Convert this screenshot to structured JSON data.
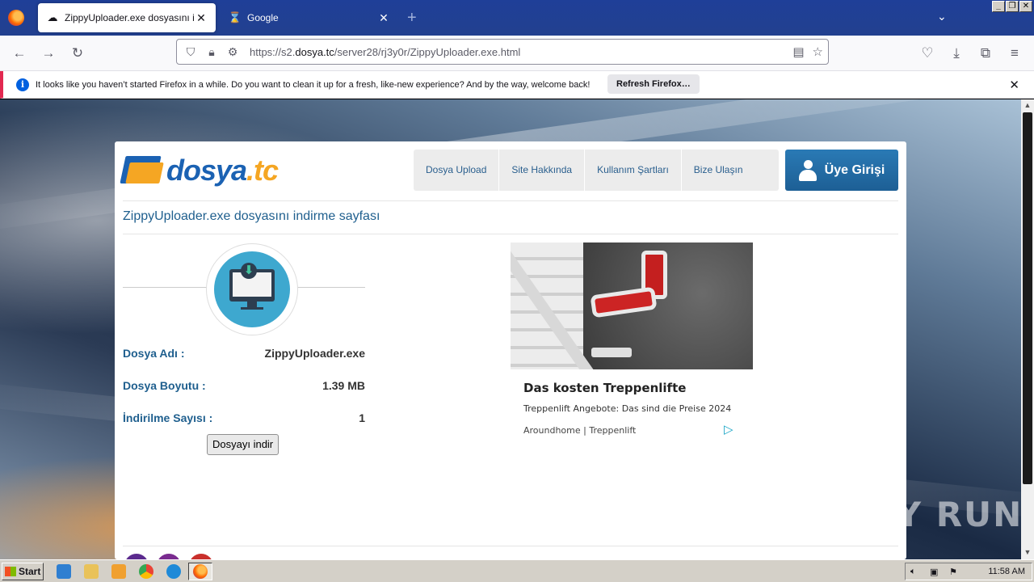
{
  "browser": {
    "tabs": [
      {
        "title": "ZippyUploader.exe dosyasını indir",
        "active": true
      },
      {
        "title": "Google",
        "active": false
      }
    ],
    "url_prefix": "https://s2.",
    "url_domain": "dosya.tc",
    "url_path": "/server28/rj3y0r/ZippyUploader.exe.html",
    "notification": {
      "message": "It looks like you haven’t started Firefox in a while. Do you want to clean it up for a fresh, like-new experience? And by the way, welcome back!",
      "button": "Refresh Firefox…"
    }
  },
  "site": {
    "logo_main": "dosya",
    "logo_tld": ".tc",
    "nav": [
      "Dosya Upload",
      "Site Hakkında",
      "Kullanım Şartları",
      "Bize Ulaşın"
    ],
    "login": "Üye Girişi",
    "page_title": "ZippyUploader.exe dosyasını indirme sayfası",
    "file": {
      "name_label": "Dosya Adı :",
      "name_value": "ZippyUploader.exe",
      "size_label": "Dosya Boyutu :",
      "size_value": "1.39 MB",
      "downloads_label": "İndirilme Sayısı :",
      "downloads_value": "1"
    },
    "download_button": "Dosyayı indir",
    "ad": {
      "title": "Das kosten Treppenlifte",
      "description": "Treppenlift Angebote: Das sind die Preise 2024",
      "source": "Aroundhome | Treppenlift"
    }
  },
  "watermark": "ANY RUN",
  "taskbar": {
    "start": "Start",
    "clock": "11:58 AM"
  }
}
